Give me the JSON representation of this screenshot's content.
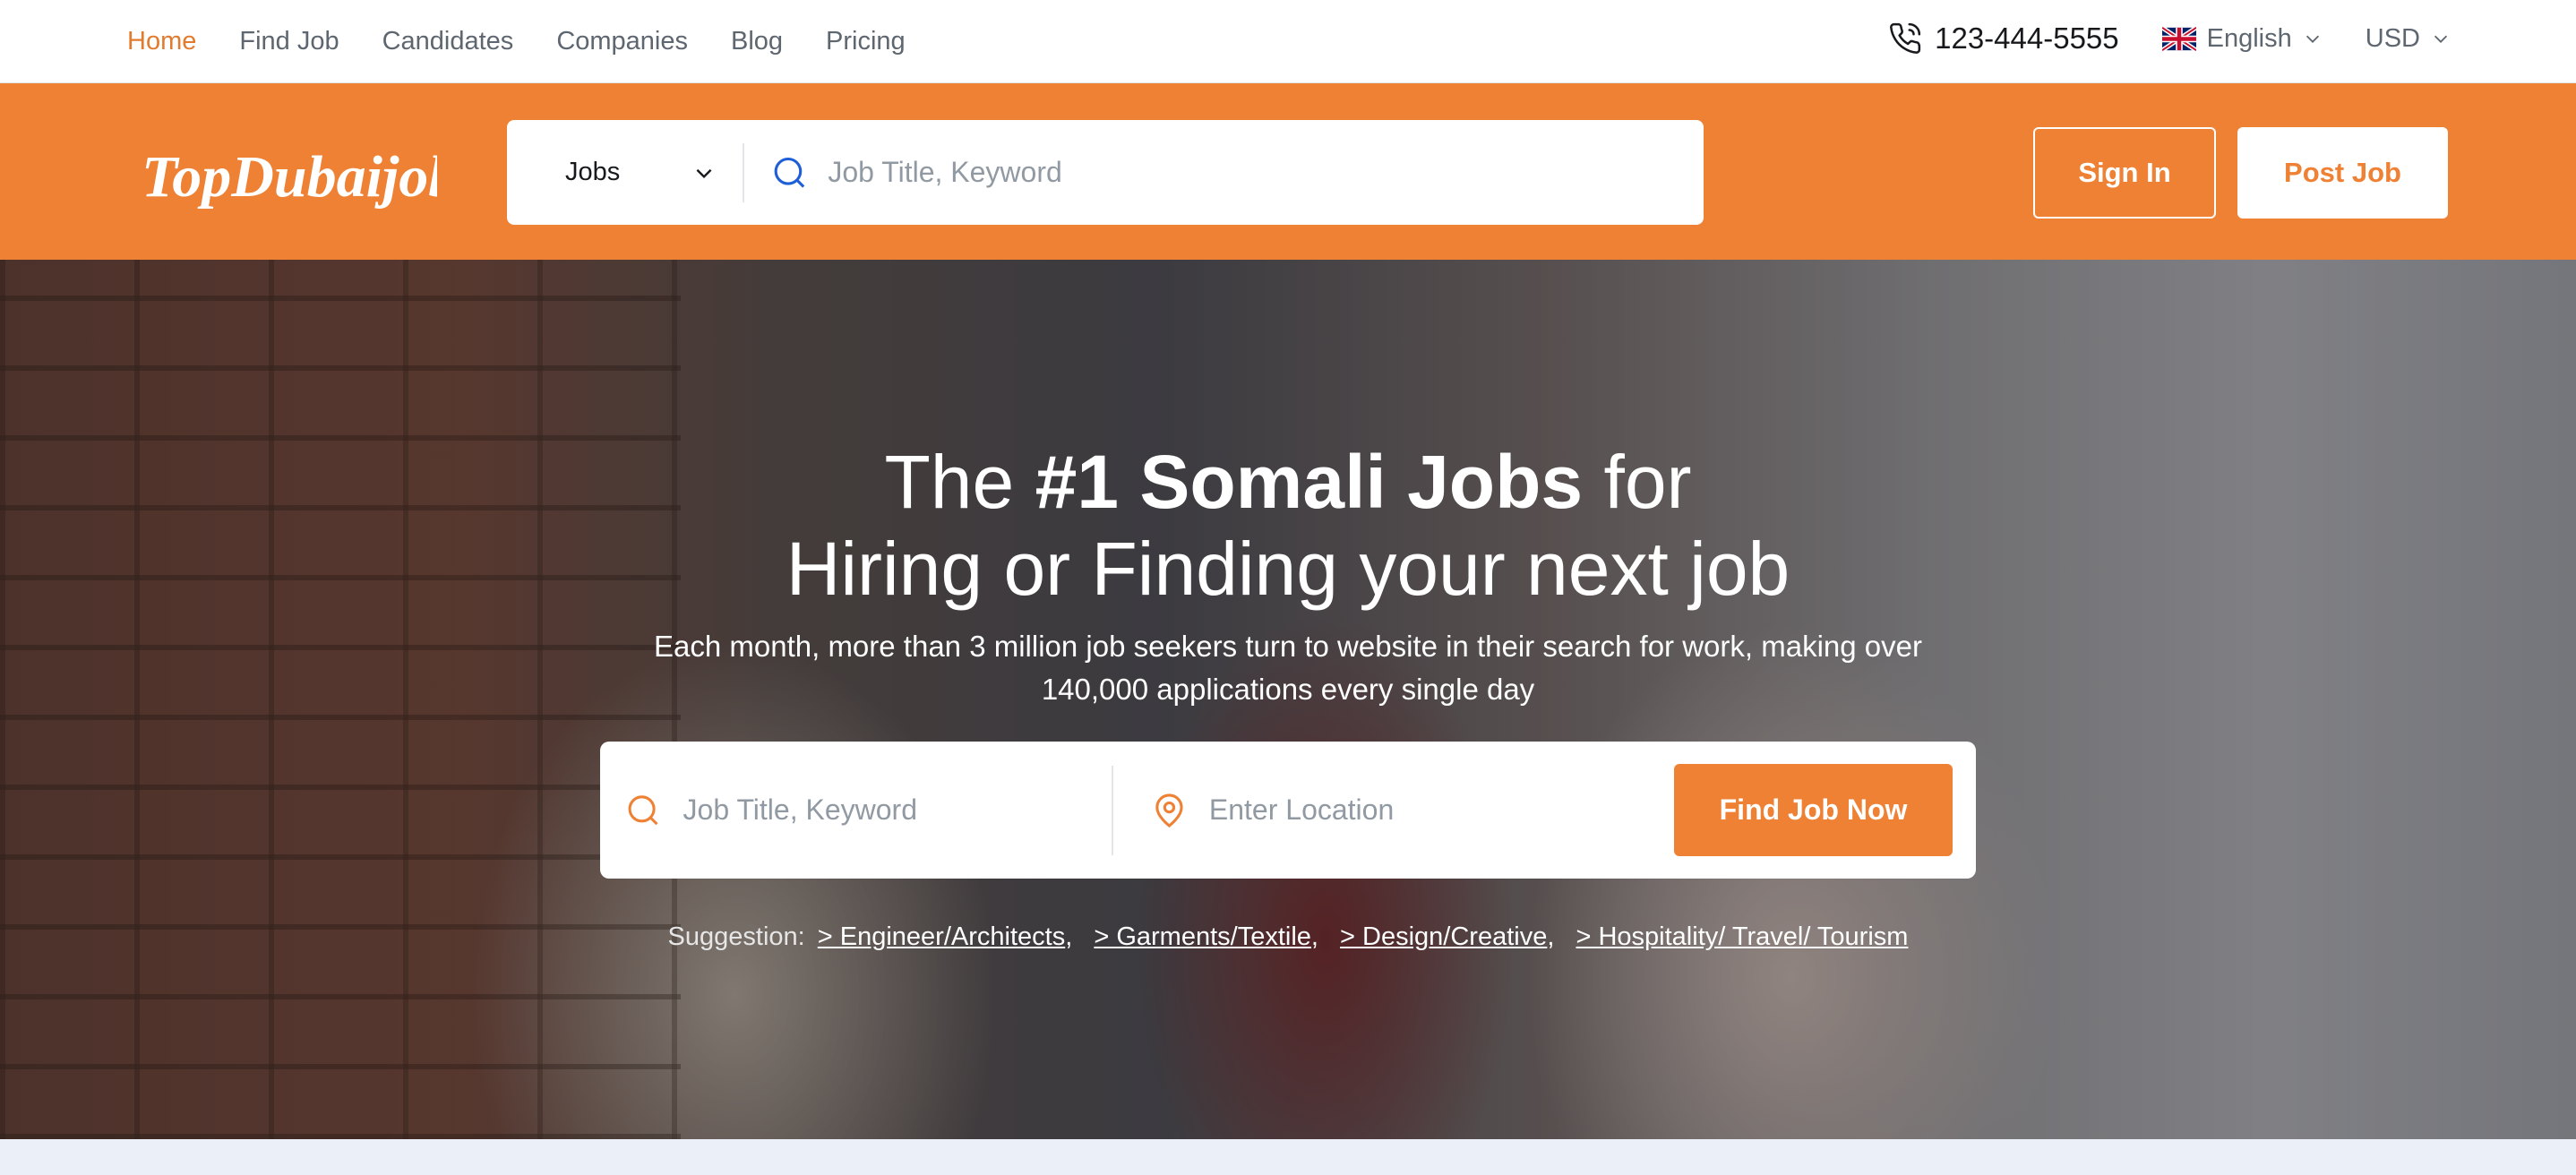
{
  "topnav": {
    "items": [
      {
        "label": "Home",
        "active": true
      },
      {
        "label": "Find Job",
        "active": false
      },
      {
        "label": "Candidates",
        "active": false
      },
      {
        "label": "Companies",
        "active": false
      },
      {
        "label": "Blog",
        "active": false
      },
      {
        "label": "Pricing",
        "active": false
      }
    ],
    "phone": "123-444-5555",
    "language": "English",
    "currency": "USD"
  },
  "header": {
    "logo_text": "TopDubaijobs",
    "search_type": "Jobs",
    "search_placeholder": "Job Title, Keyword",
    "sign_in_label": "Sign In",
    "post_job_label": "Post Job"
  },
  "hero": {
    "title_pre": "The ",
    "title_bold": "#1 Somali Jobs",
    "title_post": " for",
    "title_line2": "Hiring or Finding your next job",
    "subtitle": "Each month, more than 3 million job seekers turn to website in their search for work, making over 140,000 applications every single day",
    "keyword_placeholder": "Job Title, Keyword",
    "location_placeholder": "Enter Location",
    "find_button": "Find Job Now",
    "suggestion_label": "Suggestion:",
    "suggestions": [
      "> Engineer/Architects",
      "> Garments/Textile",
      "> Design/Creative",
      "> Hospitality/ Travel/ Tourism"
    ]
  },
  "colors": {
    "brand_orange": "#ee8134",
    "active_nav": "#e37b2e",
    "search_icon_blue": "#1e5fd8"
  },
  "icons": [
    "phone-icon",
    "uk-flag-icon",
    "chevron-down-icon",
    "search-icon",
    "map-pin-icon"
  ]
}
